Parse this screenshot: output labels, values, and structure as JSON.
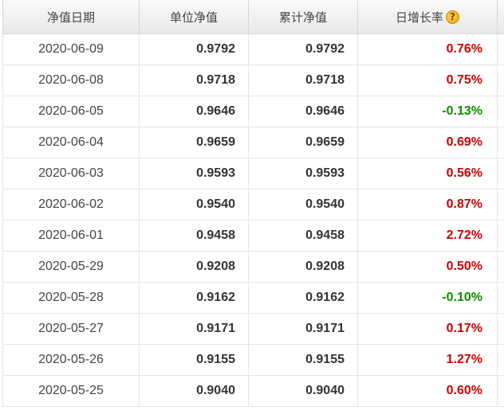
{
  "table": {
    "headers": {
      "date": "净值日期",
      "unit_nav": "单位净值",
      "acc_nav": "累计净值",
      "daily_growth": "日增长率"
    },
    "help_icon": "question-mark-icon",
    "colors": {
      "positive": "#cc0000",
      "negative": "#118c00"
    },
    "rows": [
      {
        "date": "2020-06-09",
        "unit_nav": "0.9792",
        "acc_nav": "0.9792",
        "growth": "0.76%"
      },
      {
        "date": "2020-06-08",
        "unit_nav": "0.9718",
        "acc_nav": "0.9718",
        "growth": "0.75%"
      },
      {
        "date": "2020-06-05",
        "unit_nav": "0.9646",
        "acc_nav": "0.9646",
        "growth": "-0.13%"
      },
      {
        "date": "2020-06-04",
        "unit_nav": "0.9659",
        "acc_nav": "0.9659",
        "growth": "0.69%"
      },
      {
        "date": "2020-06-03",
        "unit_nav": "0.9593",
        "acc_nav": "0.9593",
        "growth": "0.56%"
      },
      {
        "date": "2020-06-02",
        "unit_nav": "0.9540",
        "acc_nav": "0.9540",
        "growth": "0.87%"
      },
      {
        "date": "2020-06-01",
        "unit_nav": "0.9458",
        "acc_nav": "0.9458",
        "growth": "2.72%"
      },
      {
        "date": "2020-05-29",
        "unit_nav": "0.9208",
        "acc_nav": "0.9208",
        "growth": "0.50%"
      },
      {
        "date": "2020-05-28",
        "unit_nav": "0.9162",
        "acc_nav": "0.9162",
        "growth": "-0.10%"
      },
      {
        "date": "2020-05-27",
        "unit_nav": "0.9171",
        "acc_nav": "0.9171",
        "growth": "0.17%"
      },
      {
        "date": "2020-05-26",
        "unit_nav": "0.9155",
        "acc_nav": "0.9155",
        "growth": "1.27%"
      },
      {
        "date": "2020-05-25",
        "unit_nav": "0.9040",
        "acc_nav": "0.9040",
        "growth": "0.60%"
      }
    ]
  }
}
